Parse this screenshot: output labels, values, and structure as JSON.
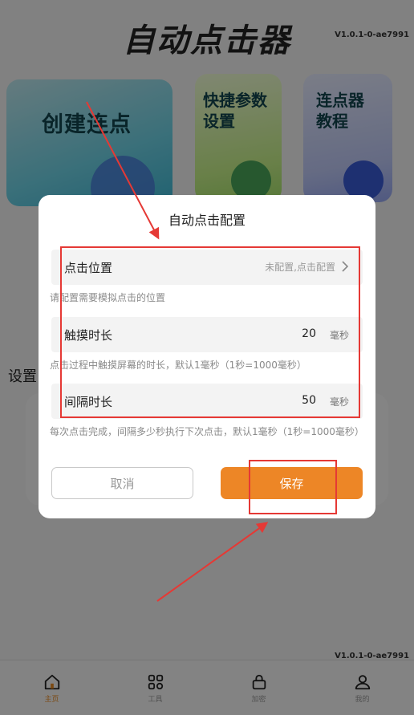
{
  "app": {
    "title": "自动点击器",
    "version": "V1.0.1-0-ae7991",
    "cards": [
      {
        "label": "创建连点"
      },
      {
        "label_line1": "快捷参数",
        "label_line2": "设置"
      },
      {
        "label_line1": "连点器",
        "label_line2": "教程"
      }
    ],
    "settings_label": "设置"
  },
  "nav": [
    {
      "label": "主页",
      "icon": "home-icon",
      "active": true
    },
    {
      "label": "工具",
      "icon": "grid-icon",
      "active": false
    },
    {
      "label": "加密",
      "icon": "lock-icon",
      "active": false
    },
    {
      "label": "我的",
      "icon": "user-icon",
      "active": false
    }
  ],
  "dialog": {
    "title": "自动点击配置",
    "position": {
      "label": "点击位置",
      "hint": "未配置,点击配置",
      "desc": "请配置需要模拟点击的位置"
    },
    "touch": {
      "label": "触摸时长",
      "value": "20",
      "unit": "毫秒",
      "desc": "点击过程中触摸屏幕的时长，默认1毫秒（1秒=1000毫秒）"
    },
    "interval": {
      "label": "间隔时长",
      "value": "50",
      "unit": "毫秒",
      "desc": "每次点击完成，间隔多少秒执行下次点击，默认1毫秒（1秒=1000毫秒）"
    },
    "cancel_label": "取消",
    "save_label": "保存"
  },
  "colors": {
    "accent": "#ed8626",
    "annotation": "#e53935"
  }
}
